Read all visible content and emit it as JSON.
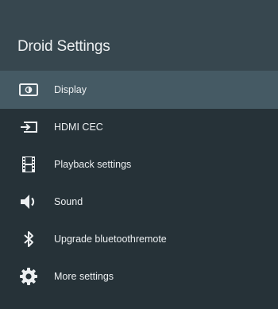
{
  "header": {
    "title": "Droid Settings"
  },
  "menu": {
    "items": [
      {
        "label": "Display",
        "icon": "display-icon",
        "selected": true
      },
      {
        "label": "HDMI CEC",
        "icon": "hdmi-input-icon",
        "selected": false
      },
      {
        "label": "Playback settings",
        "icon": "film-icon",
        "selected": false
      },
      {
        "label": "Sound",
        "icon": "speaker-icon",
        "selected": false
      },
      {
        "label": "Upgrade bluetoothremote",
        "icon": "bluetooth-icon",
        "selected": false
      },
      {
        "label": "More settings",
        "icon": "gear-icon",
        "selected": false
      }
    ]
  },
  "colors": {
    "background": "#263238",
    "header_background": "#37474f",
    "selected_background": "#455a64",
    "text": "#eceff1"
  }
}
